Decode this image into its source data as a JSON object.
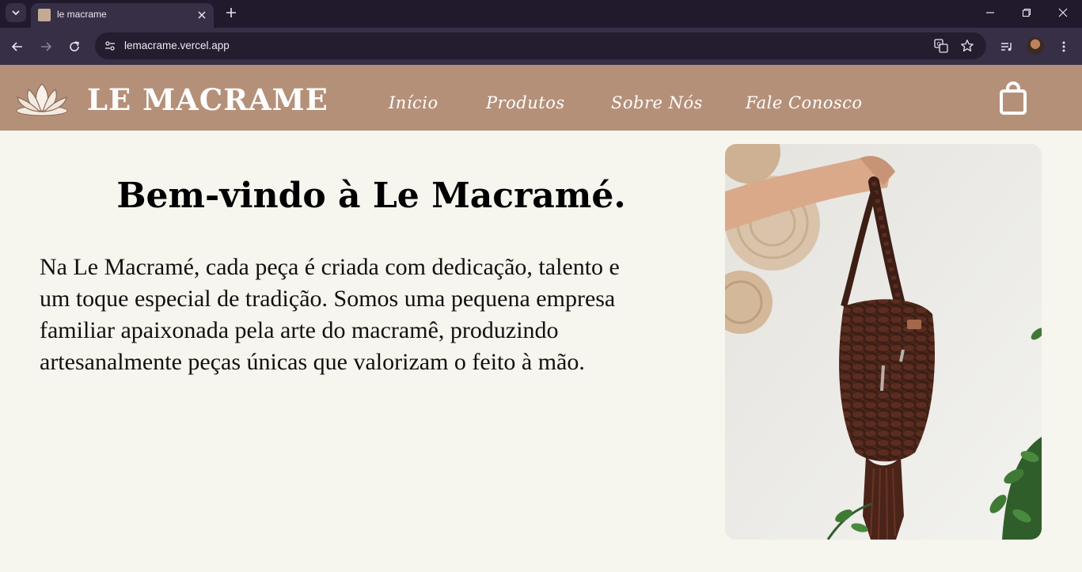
{
  "browser": {
    "tab_title": "le macrame",
    "url": "lemacrame.vercel.app"
  },
  "site": {
    "brand": "LE MACRAME",
    "nav": [
      {
        "label": "Início"
      },
      {
        "label": "Produtos"
      },
      {
        "label": "Sobre Nós"
      },
      {
        "label": "Fale Conosco"
      }
    ]
  },
  "hero": {
    "title": "Bem-vindo à Le Macramé.",
    "lines": [
      "Na Le Macramé, cada peça é criada com dedicação, talento e",
      "um toque especial de tradição. Somos uma pequena empresa",
      "familiar apaixonada pela arte do macramê, produzindo",
      "artesanalmente peças únicas que valorizam o feito à mão."
    ]
  },
  "colors": {
    "header_bg": "#b59079",
    "page_bg": "#f6f5ee",
    "bag_brown": "#4a2419"
  }
}
